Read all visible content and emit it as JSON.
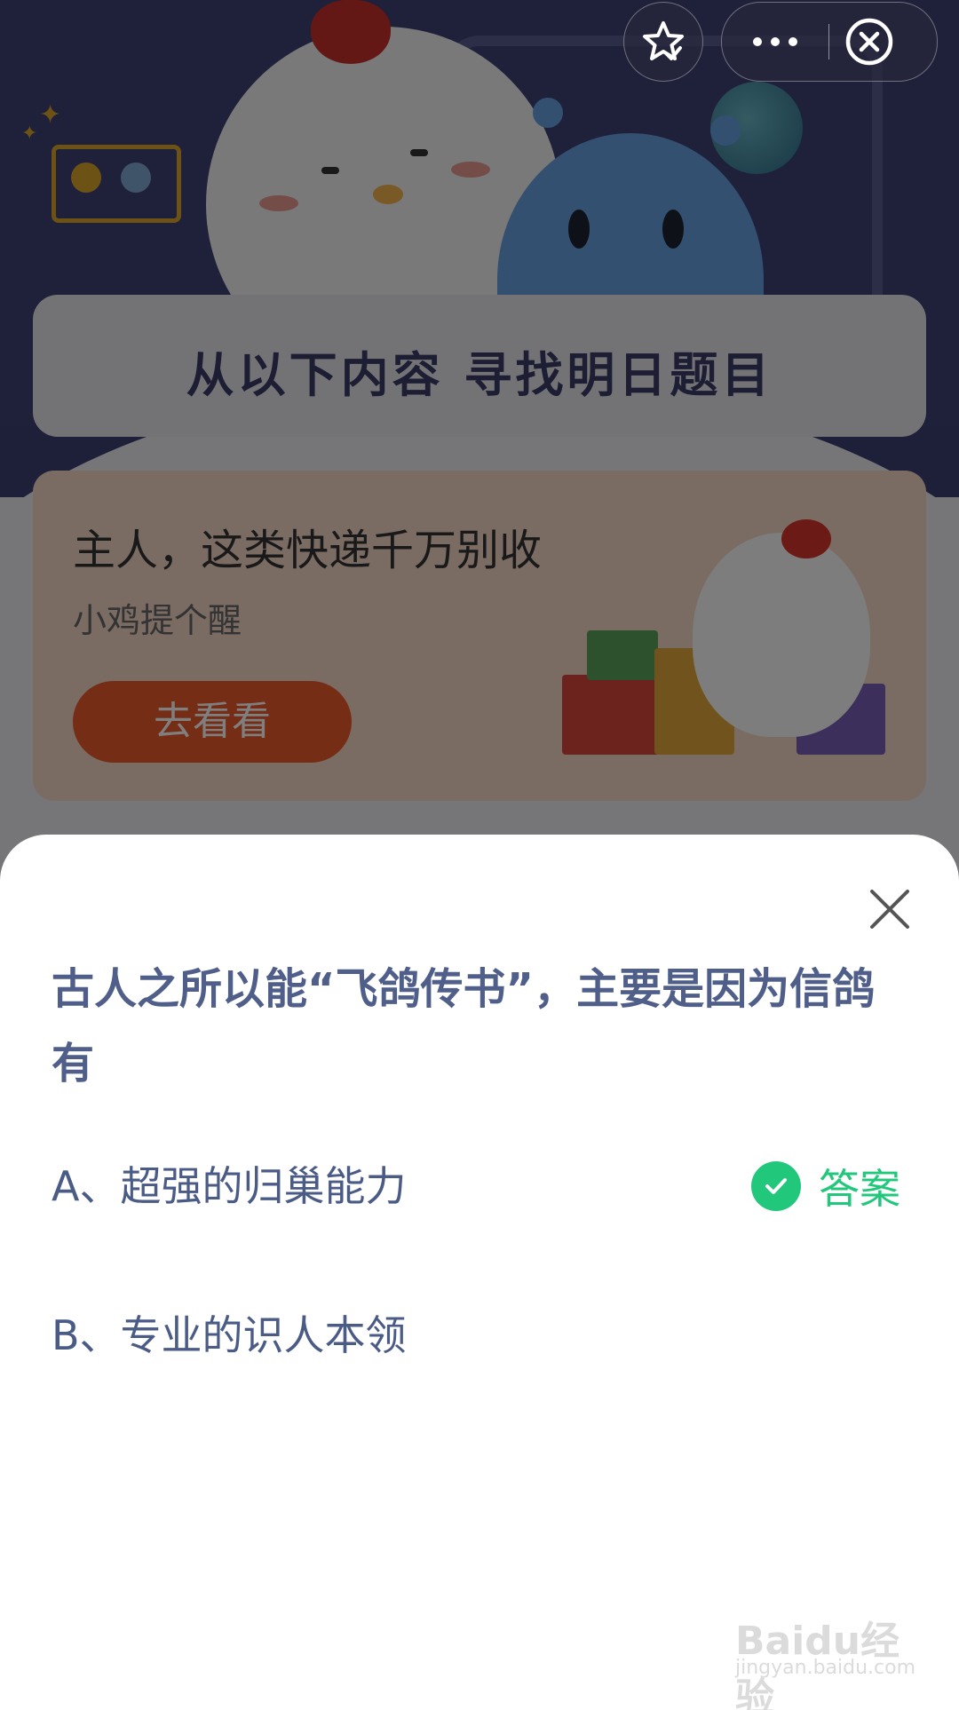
{
  "background": {
    "banner_title": "从以下内容  寻找明日题目",
    "promo": {
      "title": "主人，这类快递千万别收",
      "subtitle": "小鸡提个醒",
      "button_label": "去看看"
    }
  },
  "capsule": {
    "star_icon": "star-check-icon",
    "more_icon": "more-dots-icon",
    "close_icon": "circle-close-icon"
  },
  "sheet": {
    "question": "古人之所以能“飞鸽传书”，主要是因为信鸽有",
    "options": [
      {
        "label": "A、超强的归巢能力",
        "is_answer": true
      },
      {
        "label": "B、专业的识人本领",
        "is_answer": false
      }
    ],
    "answer_label": "答案"
  },
  "watermark": {
    "brand": "Baidu经验",
    "url": "jingyan.baidu.com"
  },
  "colors": {
    "question_text": "#4f5f8a",
    "option_text": "#4a5b86",
    "answer_green": "#21c77a",
    "promo_button": "#ea5a2b"
  }
}
